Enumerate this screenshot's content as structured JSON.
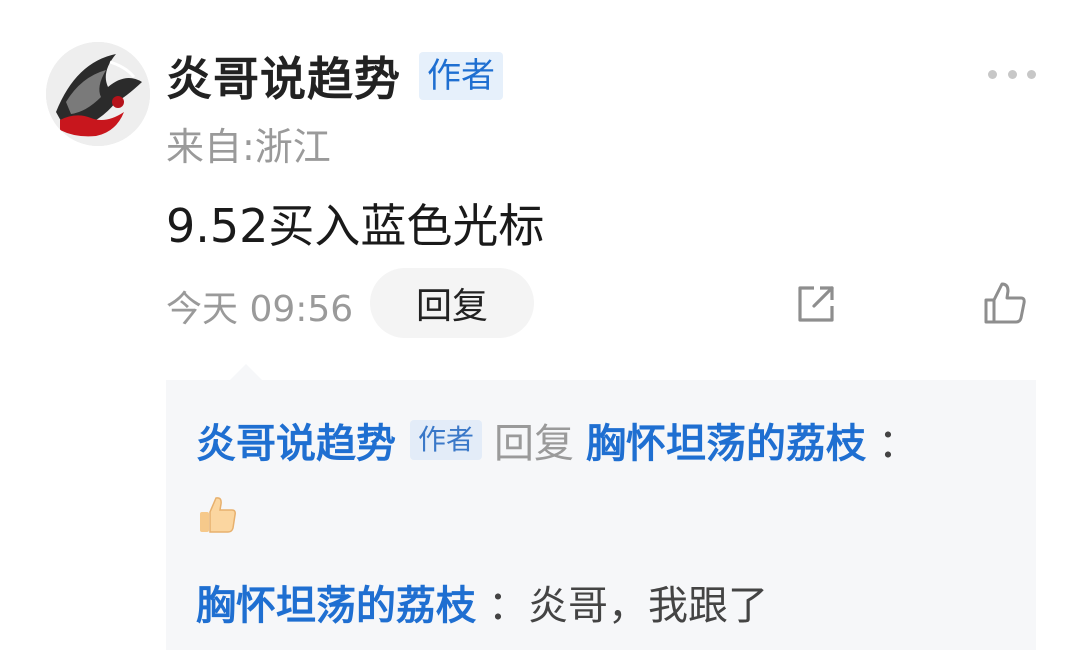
{
  "comment": {
    "author_name": "炎哥说趋势",
    "author_badge": "作者",
    "location": "来自:浙江",
    "content": "9.52买入蓝色光标",
    "time": "今天 09:56",
    "reply_button_label": "回复",
    "icons": {
      "more": "more-horizontal-icon",
      "share": "share-icon",
      "like": "thumbs-up-icon"
    }
  },
  "replies": [
    {
      "author_name": "炎哥说趋势",
      "author_badge": "作者",
      "action": "回复",
      "target_name": "胸怀坦荡的荔枝",
      "colon": "：",
      "emoji": "thumbs-up-emoji"
    },
    {
      "author_name": "胸怀坦荡的荔枝",
      "colon": "：",
      "text": "炎哥，我跟了"
    }
  ],
  "colors": {
    "link_blue": "#1f6fd1",
    "badge_bg": "#e6f0fb",
    "panel_bg": "#f6f7f9",
    "muted_text": "#9a9a9a"
  }
}
